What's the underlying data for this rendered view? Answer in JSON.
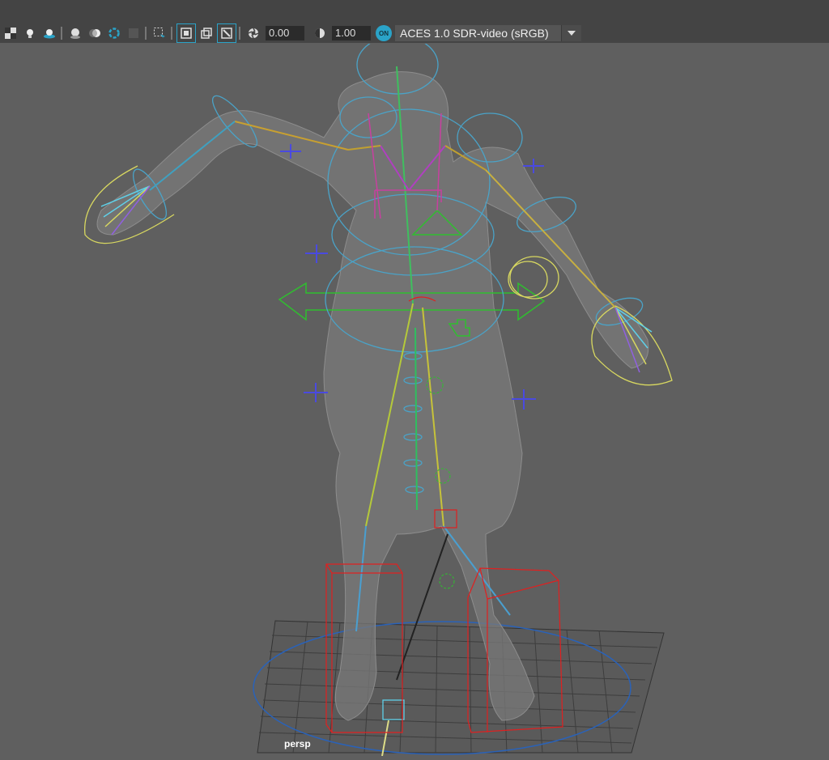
{
  "toolbar": {
    "exposure_value": "0.00",
    "gamma_value": "1.00",
    "color_management_badge": "ON",
    "color_space_value": "ACES 1.0 SDR-video (sRGB)"
  },
  "viewport": {
    "camera_label": "persp"
  },
  "colors": {
    "viewport_bg": "#5f5f5f",
    "toolbar_bg": "#444444",
    "accent": "#2aa3c8"
  }
}
